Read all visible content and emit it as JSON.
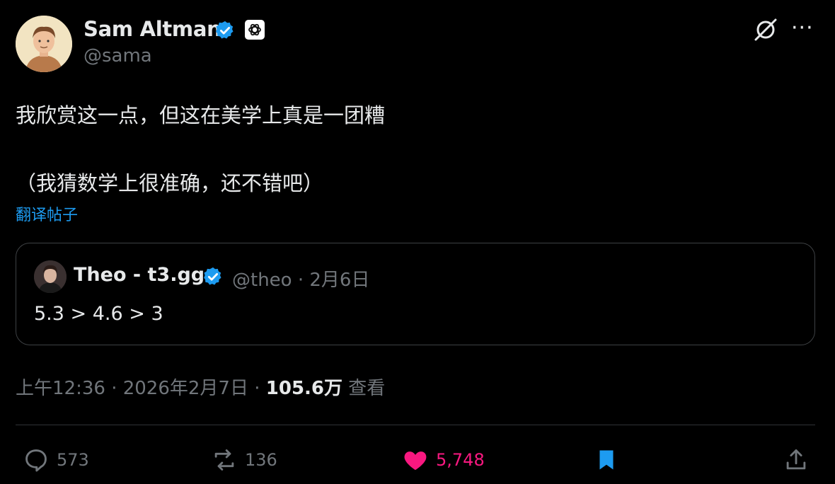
{
  "author": {
    "name": "Sam Altman",
    "handle": "@sama",
    "verified_icon": "verified-badge-icon",
    "org_icon": "openai-logo-icon"
  },
  "post": {
    "line1": "我欣赏这一点，但这在美学上真是一团糟",
    "line2": "（我猜数学上很准确，还不错吧）",
    "translate_label": "翻译帖子"
  },
  "quote": {
    "name": "Theo - t3.gg",
    "handle": "@theo",
    "date": " · 2月6日",
    "text": "5.3 > 4.6 > 3"
  },
  "meta": {
    "time": "上午12:36 · 2026年2月7日 · ",
    "views": "105.6万",
    "views_label": " 查看"
  },
  "actions": {
    "replies": "573",
    "reposts": "136",
    "likes": "5,748"
  },
  "colors": {
    "accent": "#1d9bf0",
    "like": "#f91880",
    "muted": "#71767b",
    "text": "#e7e9ea",
    "background": "#000000"
  }
}
